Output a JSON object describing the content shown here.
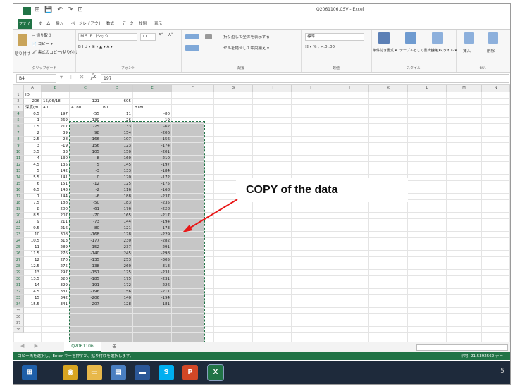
{
  "window": {
    "title": "Q2061106.CSV - Excel",
    "quick_access": "⊞ 💾 ↶ ↷ ⊡"
  },
  "ribbon_tabs": [
    "ファイル",
    "ホーム",
    "挿入",
    "ページレイアウト",
    "数式",
    "データ",
    "校閲",
    "表示"
  ],
  "ribbon": {
    "clipboard": {
      "cut": "✂ 切り取り",
      "copy": "📄 コピー ▾",
      "painter": "🖌 書式のコピー/貼り付け",
      "paste": "貼り付け",
      "label": "クリップボード"
    },
    "font": {
      "name": "ＭＳ Ｐゴシック",
      "size": "11",
      "grow": "A˄",
      "shrink": "A˅",
      "buttons": "B  I  U  ▾  ⊞ ▾  ▲ ▾  A ▾",
      "label": "フォント"
    },
    "alignment": {
      "wrap": "折り返して全体を表示する",
      "merge": "セルを結合して中央揃え ▾",
      "label": "配置"
    },
    "number": {
      "format": "標準",
      "buttons": "☷ ▾  %  ,  ←.0  .00",
      "label": "数値"
    },
    "styles": {
      "conditional": "条件付き書式 ▾",
      "table": "テーブルとして書式設定 ▾",
      "cell": "セルのスタイル ▾",
      "label": "スタイル"
    },
    "cells": {
      "insert": "挿入",
      "delete": "削除",
      "label": "セル"
    }
  },
  "formula_bar": {
    "name_box": "B4",
    "buttons": "▾ ⁝ ✕ ✓",
    "fx": "fx",
    "value": "197"
  },
  "columns": [
    "A",
    "B",
    "C",
    "D",
    "E",
    "F",
    "G",
    "H",
    "I",
    "J",
    "K",
    "L",
    "M",
    "N",
    "O"
  ],
  "selected_columns": [
    "B",
    "C",
    "D",
    "E"
  ],
  "rows": [
    [
      "ID",
      "",
      "",
      "",
      ""
    ],
    [
      "206",
      "15/06/18",
      "121",
      "605",
      ""
    ],
    [
      "深度(m)",
      "A0",
      "A180",
      "B0",
      "B180"
    ],
    [
      "0.5",
      "197",
      "-55",
      "11",
      "-80"
    ],
    [
      "1",
      "269",
      "-130",
      "-26",
      "-19"
    ],
    [
      "1.5",
      "217",
      "-75",
      "33",
      "-62"
    ],
    [
      "2",
      "39",
      "98",
      "154",
      "-206"
    ],
    [
      "2.5",
      "-28",
      "166",
      "107",
      "-156"
    ],
    [
      "3",
      "-19",
      "156",
      "123",
      "-174"
    ],
    [
      "3.5",
      "33",
      "105",
      "150",
      "-201"
    ],
    [
      "4",
      "130",
      "8",
      "160",
      "-210"
    ],
    [
      "4.5",
      "135",
      "5",
      "145",
      "-197"
    ],
    [
      "5",
      "142",
      "-3",
      "133",
      "-184"
    ],
    [
      "5.5",
      "141",
      "0",
      "120",
      "-172"
    ],
    [
      "6",
      "151",
      "-12",
      "125",
      "-175"
    ],
    [
      "6.5",
      "143",
      "-2",
      "116",
      "-168"
    ],
    [
      "7",
      "144",
      "-6",
      "188",
      "-237"
    ],
    [
      "7.5",
      "188",
      "-50",
      "183",
      "-235"
    ],
    [
      "8",
      "200",
      "-61",
      "176",
      "-228"
    ],
    [
      "8.5",
      "207",
      "-70",
      "165",
      "-217"
    ],
    [
      "9",
      "211",
      "-73",
      "144",
      "-194"
    ],
    [
      "9.5",
      "216",
      "-80",
      "121",
      "-173"
    ],
    [
      "10",
      "308",
      "-168",
      "178",
      "-229"
    ],
    [
      "10.5",
      "313",
      "-177",
      "230",
      "-282"
    ],
    [
      "11",
      "289",
      "-152",
      "237",
      "-291"
    ],
    [
      "11.5",
      "276",
      "-140",
      "245",
      "-298"
    ],
    [
      "12",
      "270",
      "-135",
      "253",
      "-305"
    ],
    [
      "12.5",
      "275",
      "-138",
      "260",
      "-313"
    ],
    [
      "13",
      "297",
      "-157",
      "175",
      "-231"
    ],
    [
      "13.5",
      "320",
      "-185",
      "175",
      "-231"
    ],
    [
      "14",
      "329",
      "-191",
      "172",
      "-226"
    ],
    [
      "14.5",
      "331",
      "-196",
      "156",
      "-211"
    ],
    [
      "15",
      "342",
      "-206",
      "140",
      "-194"
    ],
    [
      "15.5",
      "341",
      "-207",
      "128",
      "-181"
    ]
  ],
  "annotation": {
    "text": "COPY of the data"
  },
  "sheet_tab": "Q2061106",
  "add_sheet": "⊕",
  "sheet_nav": "◀ ▶",
  "status": {
    "left": "コピー先を選択し、Enter キーを押すか、貼り付けを選択します。",
    "right": "平均: 21.5392562    デー"
  },
  "taskbar": {
    "apps": [
      {
        "name": "start",
        "glyph": "⊞",
        "color": "#1f5fa8"
      },
      {
        "name": "chrome",
        "glyph": "◉",
        "color": "#d9a521"
      },
      {
        "name": "explorer",
        "glyph": "▭",
        "color": "#e8b84a"
      },
      {
        "name": "app4",
        "glyph": "▤",
        "color": "#4a7fc1"
      },
      {
        "name": "app5",
        "glyph": "▬",
        "color": "#2b5797"
      },
      {
        "name": "skype",
        "glyph": "S",
        "color": "#00aff0"
      },
      {
        "name": "powerpoint",
        "glyph": "P",
        "color": "#d24726"
      },
      {
        "name": "excel",
        "glyph": "X",
        "color": "#217346"
      }
    ],
    "corner": "5"
  }
}
